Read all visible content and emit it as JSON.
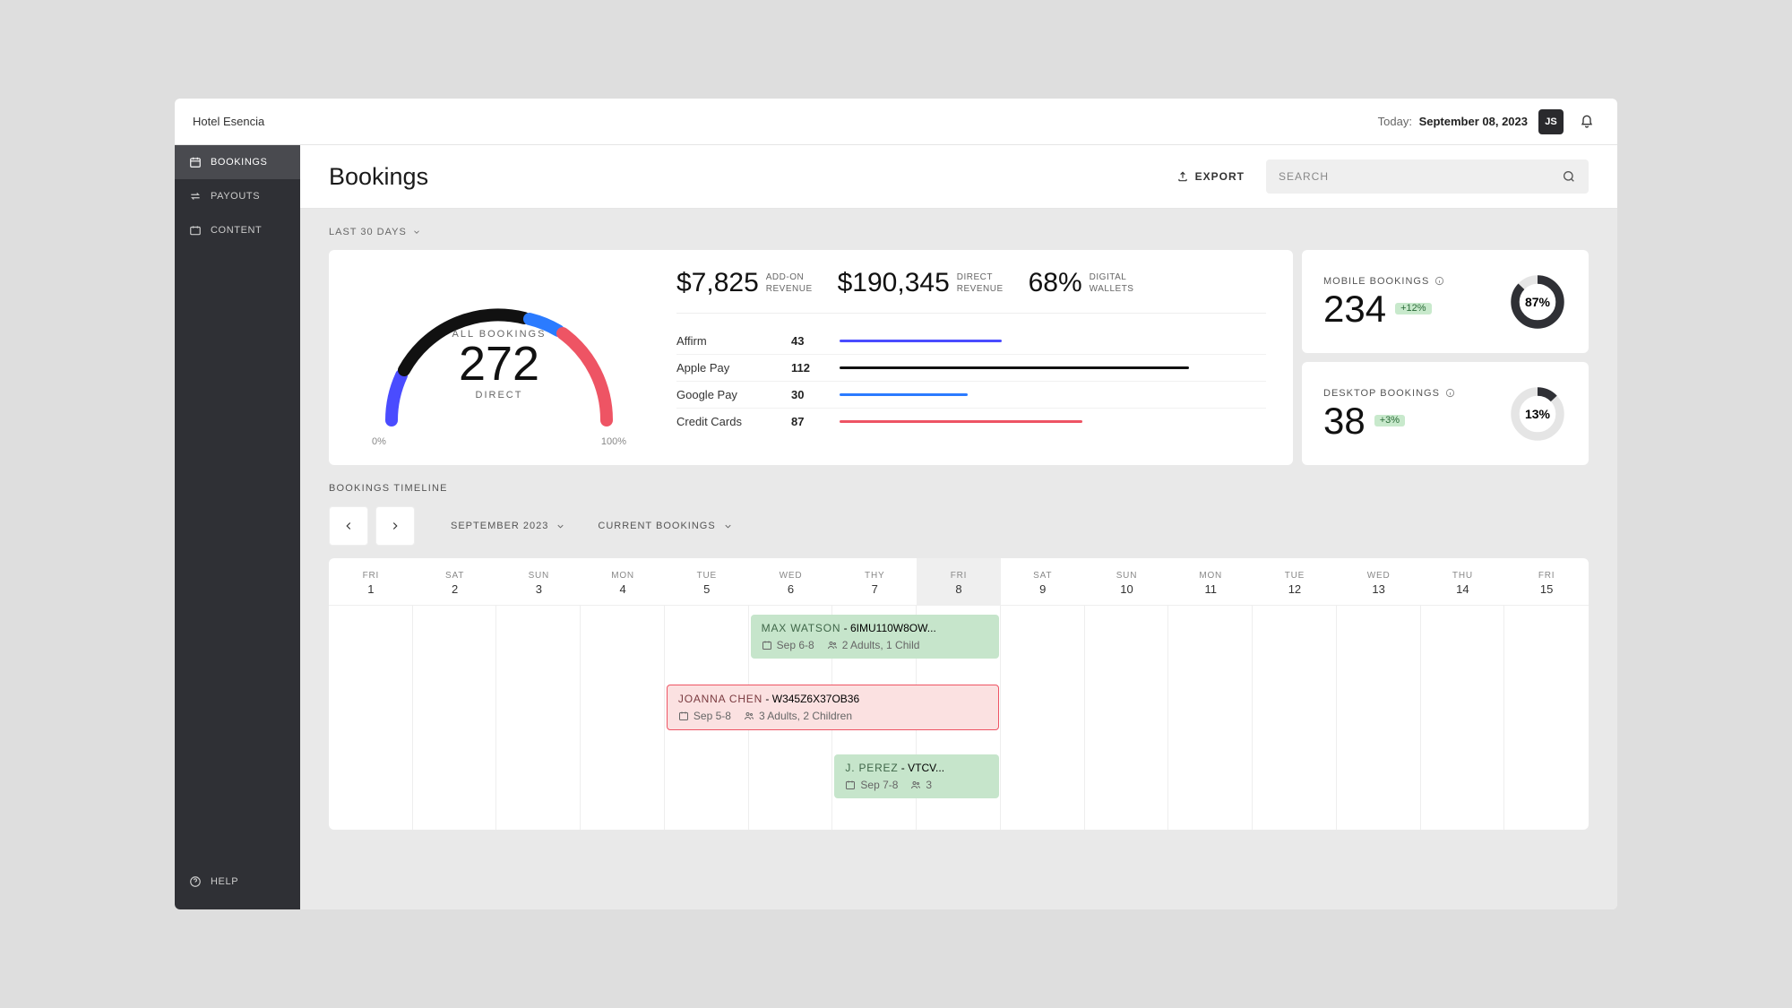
{
  "header": {
    "hotel_name": "Hotel Esencia",
    "today_label": "Today:",
    "today_date": "September 08, 2023",
    "user_initials": "JS"
  },
  "sidebar": {
    "items": [
      {
        "label": "BOOKINGS",
        "active": true
      },
      {
        "label": "PAYOUTS",
        "active": false
      },
      {
        "label": "CONTENT",
        "active": false
      }
    ],
    "help_label": "HELP"
  },
  "page": {
    "title": "Bookings",
    "export_label": "EXPORT",
    "search_placeholder": "SEARCH"
  },
  "range": {
    "label": "LAST 30 DAYS"
  },
  "gauge": {
    "label": "ALL BOOKINGS",
    "value": "272",
    "sublabel": "DIRECT",
    "scale_min": "0%",
    "scale_max": "100%"
  },
  "metrics": {
    "addon": {
      "value": "$7,825",
      "label1": "ADD-ON",
      "label2": "REVENUE"
    },
    "direct": {
      "value": "$190,345",
      "label1": "DIRECT",
      "label2": "REVENUE"
    },
    "wallets": {
      "value": "68%",
      "label1": "DIGITAL",
      "label2": "WALLETS"
    }
  },
  "payments": [
    {
      "name": "Affirm",
      "count": "43",
      "pct": 38,
      "color": "#4a4cff"
    },
    {
      "name": "Apple Pay",
      "count": "112",
      "pct": 82,
      "color": "#111111"
    },
    {
      "name": "Google Pay",
      "count": "30",
      "pct": 30,
      "color": "#2b7bff"
    },
    {
      "name": "Credit Cards",
      "count": "87",
      "pct": 57,
      "color": "#ee5464"
    }
  ],
  "mobile": {
    "title": "MOBILE BOOKINGS",
    "value": "234",
    "delta": "+12%",
    "pct": "87%",
    "pct_num": 87
  },
  "desktop": {
    "title": "DESKTOP BOOKINGS",
    "value": "38",
    "delta": "+3%",
    "pct": "13%",
    "pct_num": 13
  },
  "timeline": {
    "title": "BOOKINGS TIMELINE",
    "month_label": "SEPTEMBER 2023",
    "filter_label": "CURRENT BOOKINGS",
    "days": [
      {
        "dow": "FRI",
        "num": "1"
      },
      {
        "dow": "SAT",
        "num": "2"
      },
      {
        "dow": "SUN",
        "num": "3"
      },
      {
        "dow": "MON",
        "num": "4"
      },
      {
        "dow": "TUE",
        "num": "5"
      },
      {
        "dow": "WED",
        "num": "6"
      },
      {
        "dow": "THY",
        "num": "7"
      },
      {
        "dow": "FRI",
        "num": "8"
      },
      {
        "dow": "SAT",
        "num": "9"
      },
      {
        "dow": "SUN",
        "num": "10"
      },
      {
        "dow": "MON",
        "num": "11"
      },
      {
        "dow": "TUE",
        "num": "12"
      },
      {
        "dow": "WED",
        "num": "13"
      },
      {
        "dow": "THU",
        "num": "14"
      },
      {
        "dow": "FRI",
        "num": "15"
      }
    ],
    "today_index": 7,
    "bookings": [
      {
        "name": "MAX WATSON",
        "code": "6IMU110W8OW...",
        "date": "Sep 6-8",
        "guests": "2 Adults, 1 Child",
        "start": 6,
        "end": 8,
        "row": 0,
        "style": "green"
      },
      {
        "name": "JOANNA CHEN",
        "code": "W345Z6X37OB36",
        "date": "Sep 5-8",
        "guests": "3 Adults, 2 Children",
        "start": 5,
        "end": 8,
        "row": 1,
        "style": "pink"
      },
      {
        "name": "J. PEREZ",
        "code": "VTCV...",
        "date": "Sep 7-8",
        "guests": "3",
        "start": 7,
        "end": 8,
        "row": 2,
        "style": "green"
      }
    ]
  },
  "chart_data": [
    {
      "type": "bar",
      "title": "Payment method counts (last 30 days)",
      "categories": [
        "Affirm",
        "Apple Pay",
        "Google Pay",
        "Credit Cards"
      ],
      "values": [
        43,
        112,
        30,
        87
      ],
      "colors": [
        "#4a4cff",
        "#111111",
        "#2b7bff",
        "#ee5464"
      ]
    },
    {
      "type": "pie",
      "title": "Booking device share",
      "series": [
        {
          "name": "Mobile",
          "value": 87
        },
        {
          "name": "Desktop",
          "value": 13
        }
      ]
    }
  ]
}
